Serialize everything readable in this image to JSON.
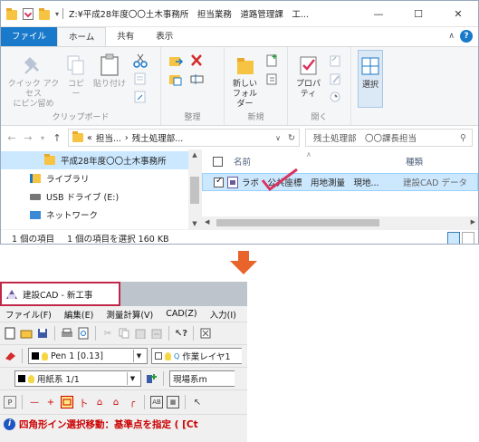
{
  "explorer": {
    "title": "Z:¥平成28年度〇〇土木事務所　担当業務　道路管理課　工...",
    "window_buttons": [
      "—",
      "☐",
      "✕"
    ],
    "tabs": [
      {
        "label": "ファイル"
      },
      {
        "label": "ホーム"
      },
      {
        "label": "共有"
      },
      {
        "label": "表示"
      }
    ],
    "ribbon": {
      "clipboard": {
        "pin_label": "クイック アクセス\nにピン留め",
        "copy_label": "コピー",
        "paste_label": "貼り付け",
        "group_label": "クリップボード"
      },
      "organize": {
        "group_label": "整理"
      },
      "new": {
        "folder_label": "新しい\nフォルダー",
        "group_label": "新規"
      },
      "open": {
        "properties_label": "プロパティ",
        "group_label": "開く"
      },
      "select": {
        "label": "選択"
      }
    },
    "address": {
      "prefix": "«",
      "crumb1": "担当...",
      "sep": "›",
      "crumb2": "残土処理部...",
      "search_placeholder": "残土処理部　〇〇課長担当"
    },
    "nav": {
      "items": [
        {
          "label": "平成28年度〇〇土木事務所"
        },
        {
          "label": "ライブラリ"
        },
        {
          "label": "USB ドライブ (E:)"
        },
        {
          "label": "ネットワーク"
        }
      ]
    },
    "list": {
      "col_name": "名前",
      "col_type": "種類",
      "file_name": "ラボ　公共座標　用地測量　現地...",
      "file_type": "建設CAD データ"
    },
    "status": {
      "count": "1 個の項目",
      "selected": "1 個の項目を選択  160 KB"
    }
  },
  "cad": {
    "title": "建設CAD - 新工事",
    "menu": [
      "ファイル(F)",
      "編集(E)",
      "測量計算(V)",
      "CAD(Z)",
      "入力(I)"
    ],
    "pen_combo": "Pen 1 [0.13]",
    "layer_combo": "作業レイヤ1",
    "paper_combo": "用紙系 1/1",
    "coord_combo": "現場系m",
    "status_message": "四角形イン選択移動：基準点を指定 ( [Ct"
  },
  "colors": {
    "accent": "#1979ca",
    "selection": "#cce8ff",
    "arrow": "#e8642a",
    "cad_title_border": "#c0284a",
    "status_red": "#cc0000",
    "checkmark": "#d9345f"
  }
}
